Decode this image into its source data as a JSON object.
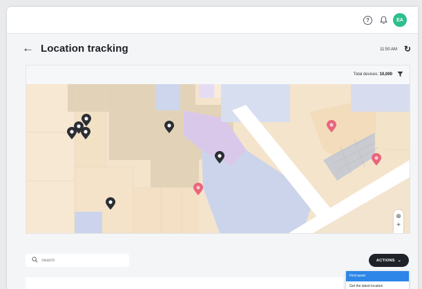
{
  "topbar": {
    "help_icon": "help-circle-icon",
    "help_glyph": "?",
    "bell_icon": "bell-icon",
    "avatar_initials": "EA",
    "avatar_color": "#2fbf8d"
  },
  "header": {
    "back_icon": "arrow-left-icon",
    "title": "Location tracking",
    "time": "11:50 AM",
    "refresh_icon": "refresh-icon"
  },
  "map": {
    "total_devices_label": "Total devices:",
    "total_devices_value": "10,000",
    "filter_icon": "filter-icon",
    "zoom_in": "+",
    "zoom_out": "−",
    "locate_icon": "locate-icon",
    "marker_colors": {
      "device": "#2b2e33",
      "alert": "#e8657b"
    }
  },
  "search": {
    "placeholder": "Search"
  },
  "actions": {
    "label": "ACTIONS",
    "options": [
      {
        "label": "Find asset",
        "selected": true
      },
      {
        "label": "Get the latest location",
        "selected": false
      }
    ],
    "accent_color": "#2d86e8"
  }
}
